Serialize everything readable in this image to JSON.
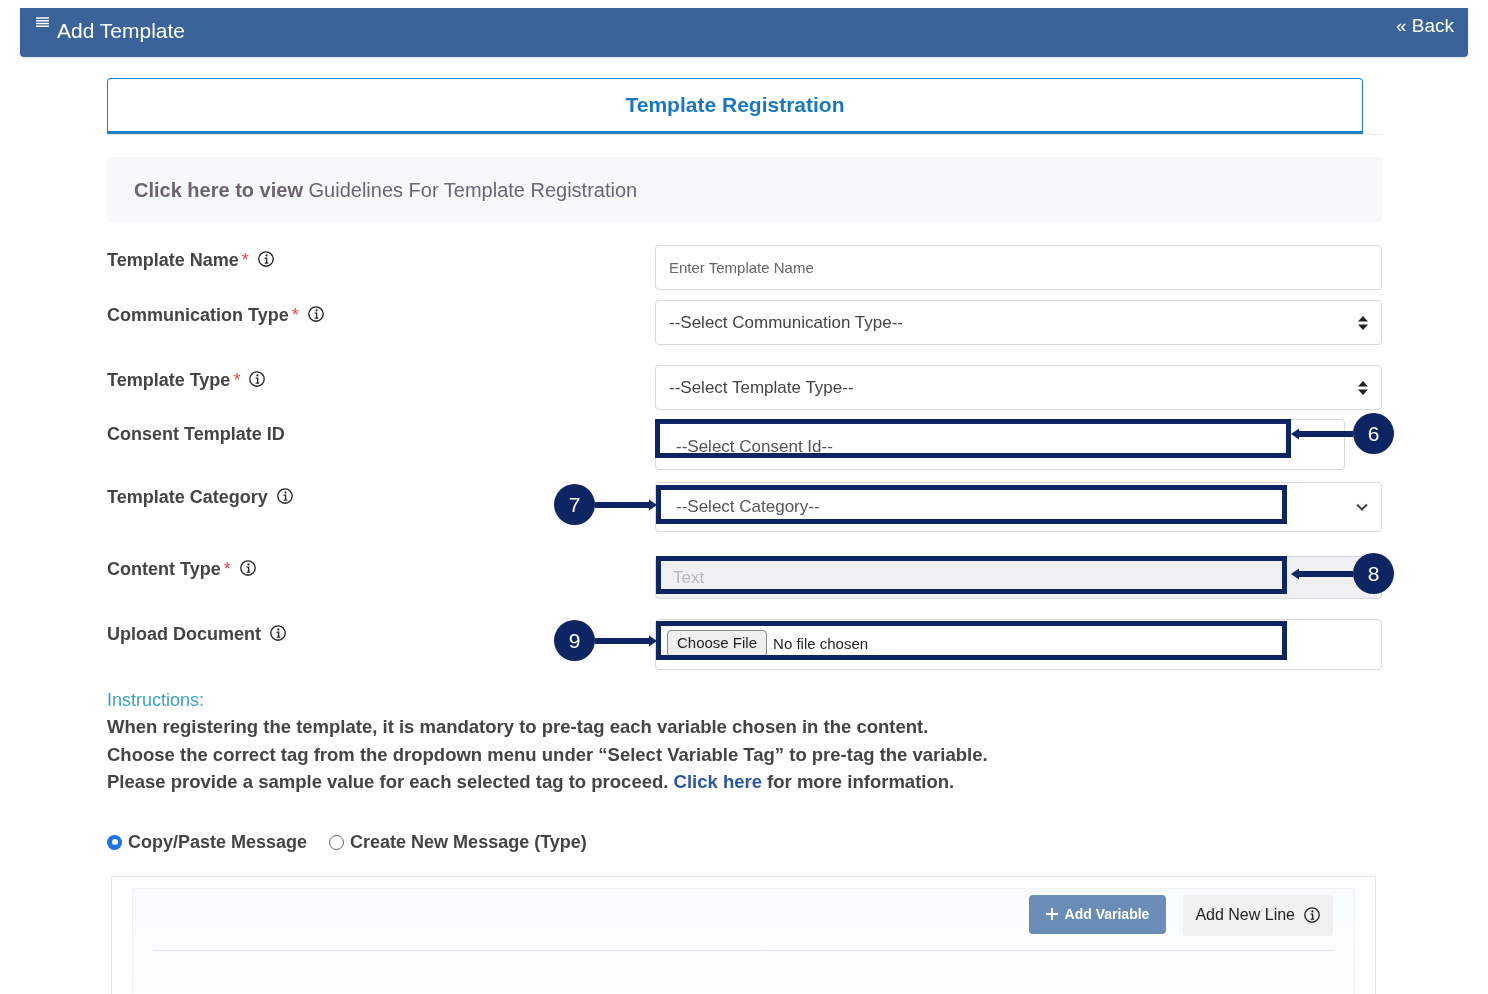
{
  "header": {
    "title": "Add Template",
    "back": "« Back"
  },
  "tab": {
    "label": "Template Registration",
    "selected": true
  },
  "guidelines": {
    "lead": "Click here to view",
    "link": "Guidelines For Template Registration"
  },
  "fields": [
    {
      "label": "Template Name",
      "required_mark": "*",
      "info": true,
      "kind": "input",
      "placeholder": "Enter Template Name"
    },
    {
      "label": "Communication Type",
      "required_mark": "*",
      "info": true,
      "kind": "select",
      "value": "--Select Communication Type--"
    },
    {
      "label": "Template Type",
      "required_mark": "*",
      "info": true,
      "kind": "select",
      "value": "--Select Template Type--"
    },
    {
      "label": "Consent Template ID",
      "info": false,
      "kind": "plain-select",
      "value": "--Select Consent Id--",
      "callout": {
        "number": "6",
        "badge_left": false
      }
    },
    {
      "label": "Template Category",
      "info": true,
      "kind": "chevron-select",
      "value": "--Select Category--",
      "callout": {
        "number": "7",
        "badge_left": true
      }
    },
    {
      "label": "Content Type",
      "required_mark": "*",
      "info": true,
      "kind": "disabled",
      "placeholder": "Text",
      "callout": {
        "number": "8",
        "badge_left": false
      }
    },
    {
      "label": "Upload Document",
      "info": true,
      "kind": "file",
      "button": "Choose File",
      "status": "No file chosen",
      "callout": {
        "number": "9",
        "badge_left": true
      }
    }
  ],
  "instructions": {
    "title": "Instructions:",
    "lines": [
      {
        "text": "When registering the template, it is mandatory to pre-tag each variable chosen in the content."
      },
      {
        "text": "Choose the correct tag from the dropdown menu under “Select Variable Tag” to pre-tag the variable."
      },
      {
        "text": "Please provide a sample value for each selected tag to proceed.",
        "link": "Click here",
        "after": "for more information."
      }
    ]
  },
  "message_modes": [
    {
      "label": "Copy/Paste Message",
      "selected": true
    },
    {
      "label": "Create New Message (Type)",
      "selected": false
    }
  ],
  "editor": {
    "buttons": [
      {
        "label": "Add Variable",
        "kind": "primary"
      },
      {
        "label": "Add New Line",
        "kind": "secondary"
      }
    ]
  }
}
